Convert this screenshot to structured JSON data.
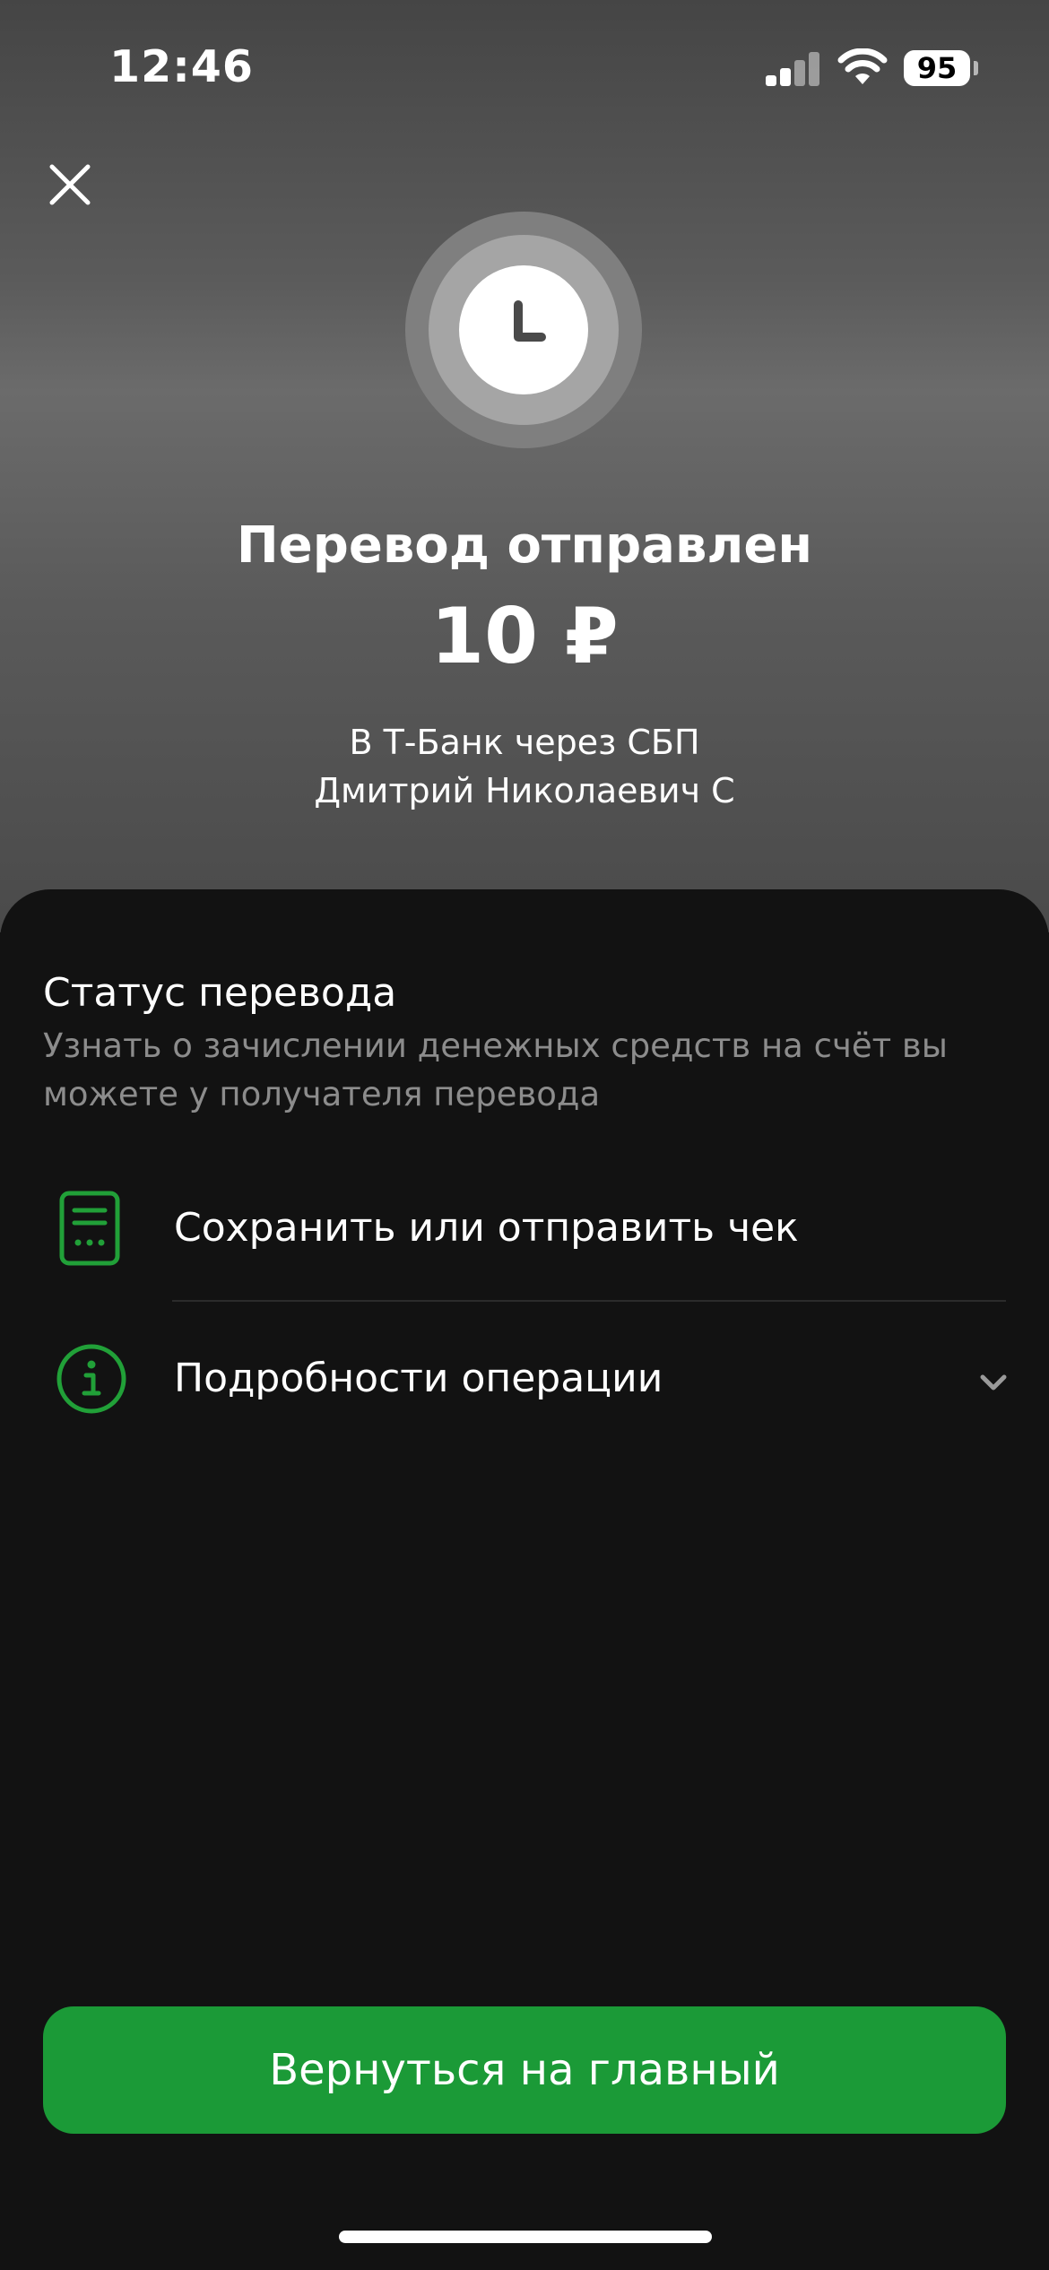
{
  "status_bar": {
    "time": "12:46",
    "battery": "95"
  },
  "header": {
    "title": "Перевод отправлен",
    "amount": "10 ₽",
    "destination": "В Т-Банк через СБП",
    "recipient": "Дмитрий Николаевич С"
  },
  "status_section": {
    "title": "Статус перевода",
    "description": "Узнать о зачислении денежных средств на счёт вы можете у получателя перевода"
  },
  "actions": [
    {
      "label": "Сохранить или отправить чек",
      "icon": "receipt-icon"
    },
    {
      "label": "Подробности операции",
      "icon": "info-icon"
    }
  ],
  "primary_button": {
    "label": "Вернуться на главный"
  },
  "colors": {
    "accent_green": "#1b9a37",
    "icon_green": "#21a038",
    "sheet_background": "#121212",
    "secondary_text": "#8c8c8c"
  }
}
